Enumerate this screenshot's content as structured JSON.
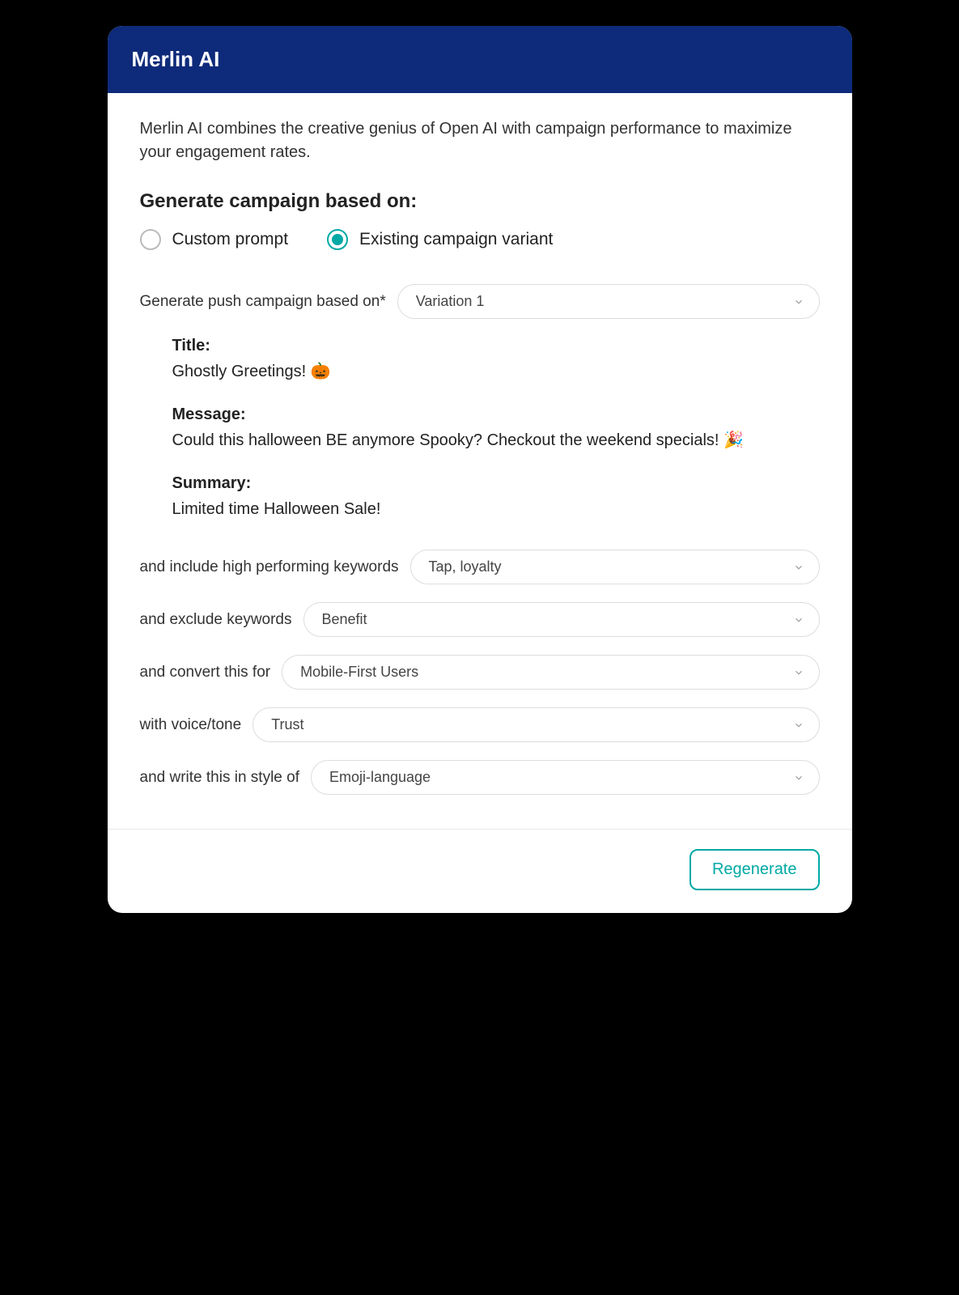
{
  "header": {
    "title": "Merlin AI"
  },
  "intro": "Merlin AI combines the creative genius of Open AI with campaign performance to maximize your engagement rates.",
  "sectionTitle": "Generate campaign based on:",
  "radios": {
    "custom": "Custom prompt",
    "existing": "Existing campaign variant"
  },
  "fields": {
    "basedOnLabel": "Generate push campaign based on*",
    "basedOnValue": "Variation 1",
    "includeLabel": "and include high performing keywords",
    "includeValue": "Tap, loyalty",
    "excludeLabel": "and exclude keywords",
    "excludeValue": "Benefit",
    "convertLabel": "and convert this for",
    "convertValue": "Mobile-First Users",
    "toneLabel": "with voice/tone",
    "toneValue": "Trust",
    "styleLabel": "and write this in style of",
    "styleValue": "Emoji-language"
  },
  "preview": {
    "titleLabel": "Title:",
    "titleValue": "Ghostly Greetings! 🎃",
    "messageLabel": "Message:",
    "messageValue": "Could this halloween BE anymore Spooky? Checkout the weekend specials! 🎉",
    "summaryLabel": "Summary:",
    "summaryValue": "Limited time Halloween Sale!"
  },
  "footer": {
    "regenerate": "Regenerate"
  }
}
